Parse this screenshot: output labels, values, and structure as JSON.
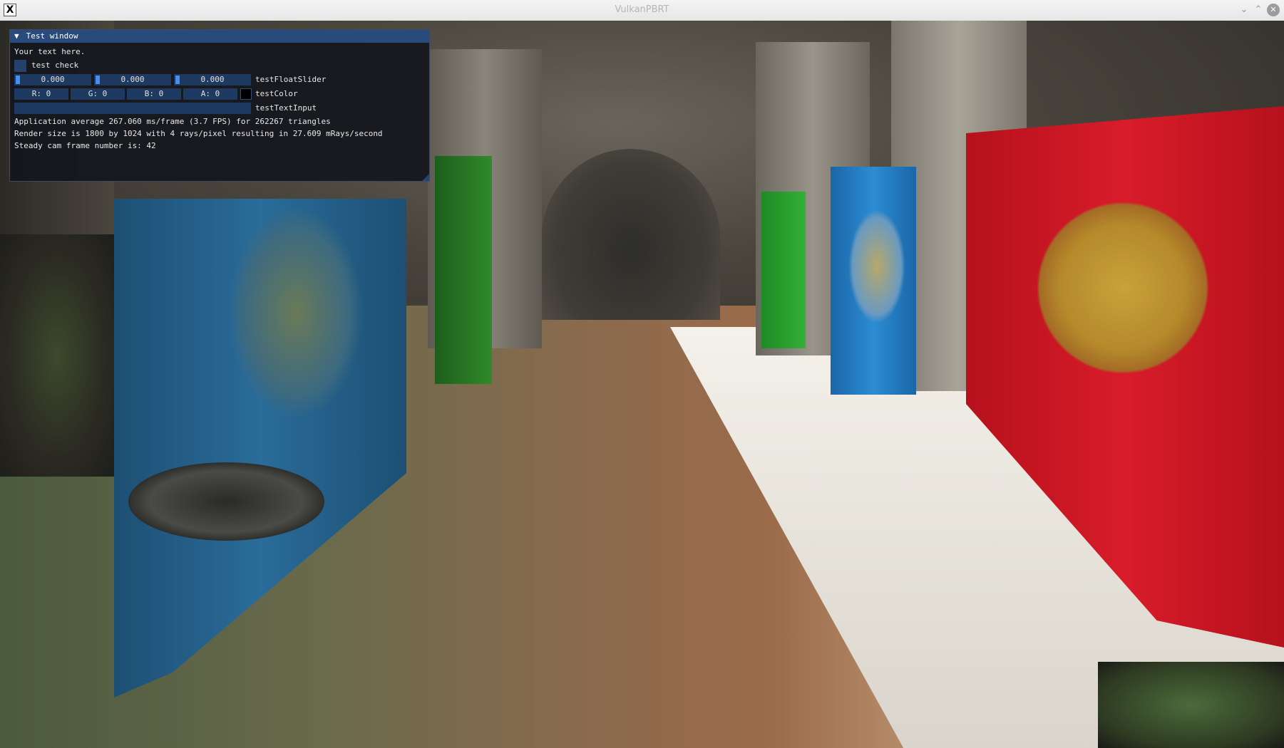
{
  "window": {
    "title": "VulkanPBRT",
    "app_icon_glyph": "X",
    "buttons": {
      "minimize": "⌄",
      "maximize": "⌃",
      "close": "✕"
    }
  },
  "imgui": {
    "title": "Test window",
    "collapse_arrow": "▼",
    "text": "Your text here.",
    "checkbox": {
      "label": "test check",
      "checked": false
    },
    "float_slider": {
      "values": [
        "0.000",
        "0.000",
        "0.000"
      ],
      "label": "testFloatSlider"
    },
    "color": {
      "r": "R:  0",
      "g": "G:  0",
      "b": "B:  0",
      "a": "A:  0",
      "label": "testColor",
      "swatch_color": "#000000"
    },
    "text_input": {
      "value": "",
      "label": "testTextInput"
    },
    "stats": [
      "Application average 267.060 ms/frame (3.7 FPS) for 262267 triangles",
      "Render size is 1800 by 1024 with 4 rays/pixel resulting in 27.609 mRays/second",
      "Steady cam frame number is: 42"
    ]
  },
  "colors": {
    "imgui_title_bg": "#294a7a",
    "imgui_frame_bg": "#1f3a60",
    "imgui_accent": "#4a8df0",
    "window_bg": "#14161c"
  }
}
